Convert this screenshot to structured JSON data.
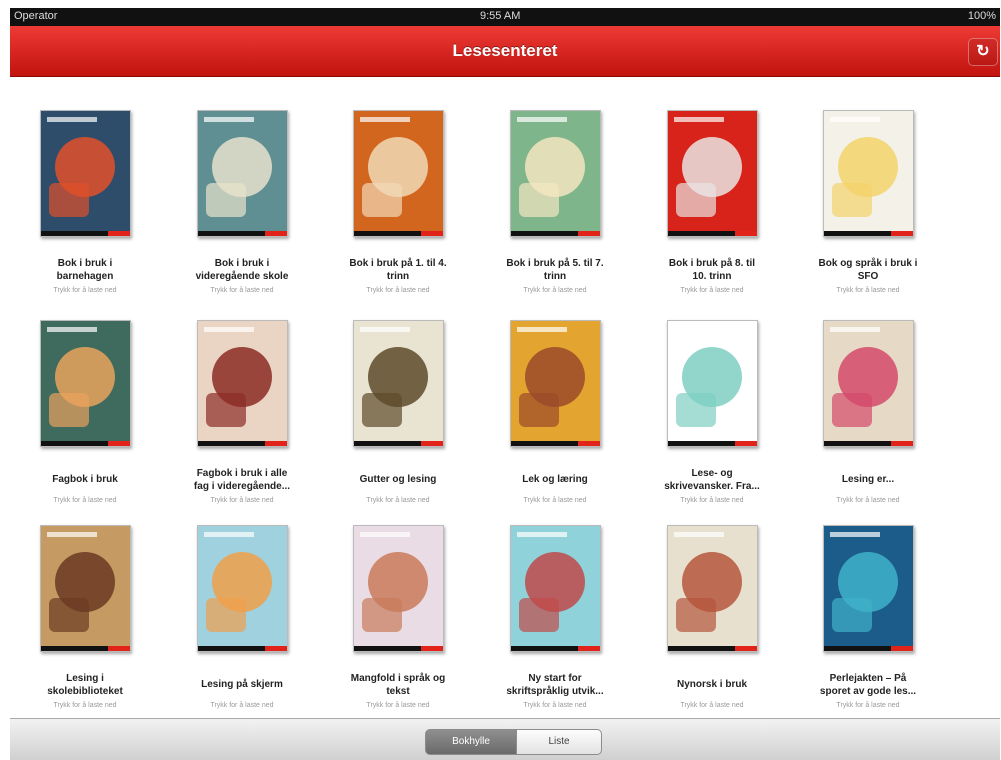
{
  "status_bar": {
    "carrier": "Operator",
    "time": "9:55 AM",
    "battery": "100%"
  },
  "nav": {
    "title": "Lesesenteret",
    "refresh_icon": "refresh-icon"
  },
  "books": [
    {
      "title_l1": "Bok i bruk i",
      "title_l2": "barnehagen",
      "subtitle": "Trykk for å laste ned",
      "cover": "#2e4d6b",
      "art": "#e0502a"
    },
    {
      "title_l1": "Bok i bruk i",
      "title_l2": "videregående skole",
      "subtitle": "Trykk for å laste ned",
      "cover": "#5f8f93",
      "art": "#e8e2cc"
    },
    {
      "title_l1": "Bok i bruk på 1. til 4.",
      "title_l2": "trinn",
      "subtitle": "Trykk for å laste ned",
      "cover": "#d2661f",
      "art": "#f1d9b6"
    },
    {
      "title_l1": "Bok i bruk på 5. til 7.",
      "title_l2": "trinn",
      "subtitle": "Trykk for å laste ned",
      "cover": "#7fb58a",
      "art": "#f3e6c0"
    },
    {
      "title_l1": "Bok i bruk på 8. til",
      "title_l2": "10. trinn",
      "subtitle": "Trykk for å laste ned",
      "cover": "#d8231a",
      "art": "#e9e4e2"
    },
    {
      "title_l1": "Bok og språk i bruk i",
      "title_l2": "SFO",
      "subtitle": "Trykk for å laste ned",
      "cover": "#f4f1e8",
      "art": "#f2d36a"
    },
    {
      "title_l1": "Fagbok i bruk",
      "title_l2": "",
      "subtitle": "Trykk for å laste ned",
      "cover": "#3f6a5e",
      "art": "#e9a35c"
    },
    {
      "title_l1": "Fagbok i bruk i alle",
      "title_l2": "fag i videregående...",
      "subtitle": "Trykk for å laste ned",
      "cover": "#ead4c4",
      "art": "#8c2c25"
    },
    {
      "title_l1": "Gutter og lesing",
      "title_l2": "",
      "subtitle": "Trykk for å laste ned",
      "cover": "#e9e3d2",
      "art": "#5d4a2a"
    },
    {
      "title_l1": "Lek og læring",
      "title_l2": "",
      "subtitle": "Trykk for å laste ned",
      "cover": "#e4a530",
      "art": "#9b4a2a"
    },
    {
      "title_l1": "Lese- og",
      "title_l2": "skrivevansker. Fra...",
      "subtitle": "Trykk for å laste ned",
      "cover": "#ffffff",
      "art": "#7fcfc2"
    },
    {
      "title_l1": "Lesing er...",
      "title_l2": "",
      "subtitle": "Trykk for å laste ned",
      "cover": "#e6d9c6",
      "art": "#d44a6a"
    },
    {
      "title_l1": "Lesing i",
      "title_l2": "skolebiblioteket",
      "subtitle": "Trykk for å laste ned",
      "cover": "#c69a63",
      "art": "#6b3a22"
    },
    {
      "title_l1": "Lesing på skjerm",
      "title_l2": "",
      "subtitle": "Trykk for å laste ned",
      "cover": "#9fd1df",
      "art": "#f0a04a"
    },
    {
      "title_l1": "Mangfold i språk og",
      "title_l2": "tekst",
      "subtitle": "Trykk for å laste ned",
      "cover": "#eadce4",
      "art": "#c97a5a"
    },
    {
      "title_l1": "Ny start for",
      "title_l2": "skriftspråklig utvik...",
      "subtitle": "Trykk for å laste ned",
      "cover": "#8fd2da",
      "art": "#c04a4a"
    },
    {
      "title_l1": "Nynorsk i bruk",
      "title_l2": "",
      "subtitle": "Trykk for å laste ned",
      "cover": "#e8e0cf",
      "art": "#b5563c"
    },
    {
      "title_l1": "Perlejakten – På",
      "title_l2": "sporet av gode les...",
      "subtitle": "Trykk for å laste ned",
      "cover": "#1c5c8a",
      "art": "#3fb2c9"
    }
  ],
  "toolbar": {
    "grid_label": "Bokhylle",
    "list_label": "Liste"
  }
}
